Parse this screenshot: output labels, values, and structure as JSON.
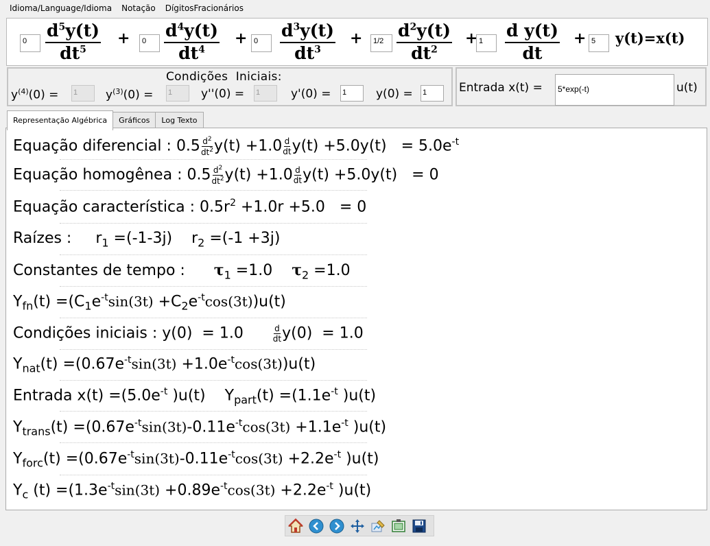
{
  "menu": [
    "Idioma/Language/Idioma",
    "Notação",
    "DígitosFracionários"
  ],
  "coefs": [
    "0",
    "0",
    "0",
    "1/2",
    "1",
    "5"
  ],
  "eq": {
    "d": "d",
    "dt": "dt",
    "yt": "y(t)",
    "y5": "5",
    "y4": "4",
    "y3": "3",
    "y2": "2",
    "plus": "+",
    "rhs": "y(t)=x(t)"
  },
  "ic": {
    "title": "Condições  Iniciais:",
    "labels": [
      "y",
      "(4)",
      "(0) =",
      "y",
      "(3)",
      "(0) =",
      "y''(0) =",
      "y'(0) =",
      "y(0) ="
    ],
    "values": [
      "1",
      "1",
      "1",
      "1",
      "1"
    ]
  },
  "input": {
    "label": "Entrada x(t) =",
    "value": "5*exp(-t)",
    "unit": "u(t)"
  },
  "tabs": [
    "Representação Algébrica",
    "Gráficos",
    "Log Texto"
  ],
  "lines": {
    "l1": {
      "label": "Equação diferencial :",
      "c1": "0.5",
      "c2": "+1.0",
      "c3": "+5.0y(t)",
      "rhs": "=  5.0e",
      "exp": "-t",
      "yt": "y(t)"
    },
    "l2": {
      "label": "Equação homogênea :",
      "c1": "0.5",
      "c2": "+1.0",
      "c3": "+5.0y(t)",
      "rhs": "= 0",
      "yt": "y(t)"
    },
    "l3": {
      "label": "Equação característica :",
      "c1": "0.5r",
      "exp": "2",
      "rest": " +1.0r +5.0   = 0"
    },
    "l4": {
      "label": "Raízes :",
      "r": "r",
      "s1": "1",
      "v1": " =(-1-3j)",
      "s2": "2",
      "v2": " =(-1 +3j)"
    },
    "l5": {
      "label": "Constantes de tempo :",
      "tau": "τ",
      "s1": "1",
      "v1": " =1.0",
      "s2": "2",
      "v2": " =1.0"
    },
    "l6": {
      "Y": "Y",
      "sub": "fn",
      "a": "(t) =(C",
      "s1": "1",
      "b": "e",
      "exp": "-t",
      "sin": "sin(3t)",
      "c": " +C",
      "s2": "2",
      "cos": "cos(3t)",
      "d": ")u(t)"
    },
    "l7": {
      "label": "Condições iniciais :",
      "a": "y(0)  = 1.0",
      "b": "y(0)  = 1.0"
    },
    "l8": {
      "Y": "Y",
      "sub": "nat",
      "a": "(t) =(0.67e",
      "exp": "-t",
      "sin": "sin(3t)",
      "b": " +1.0e",
      "cos": "cos(3t)",
      "c": ")u(t)"
    },
    "l9": {
      "a": "Entrada x(t) =(5.0e",
      "exp": "-t",
      "b": " )u(t)    Y",
      "sub": "part",
      "c": "(t) =(1.1e",
      "d": " )u(t)"
    },
    "l10": {
      "Y": "Y",
      "sub": "trans",
      "a": "(t) =(0.67e",
      "exp": "-t",
      "sin": "sin(3t)",
      "b": "-0.11e",
      "cos": "cos(3t)",
      "c": " +1.1e",
      "d": " )u(t)"
    },
    "l11": {
      "Y": "Y",
      "sub": "forc",
      "a": "(t) =(0.67e",
      "exp": "-t",
      "sin": "sin(3t)",
      "b": "-0.11e",
      "cos": "cos(3t)",
      "c": " +2.2e",
      "d": " )u(t)"
    },
    "l12": {
      "Y": "Y",
      "sub": "c",
      "a": " (t) =(1.3e",
      "exp": "-t",
      "sin": "sin(3t)",
      "b": " +0.89e",
      "cos": "cos(3t)",
      "c": " +2.2e",
      "d": " )u(t)"
    }
  },
  "toolbar": [
    "home-icon",
    "back-arrow-icon",
    "forward-arrow-icon",
    "pan-icon",
    "configure-subplots-icon",
    "edit-axes-icon",
    "save-icon"
  ]
}
